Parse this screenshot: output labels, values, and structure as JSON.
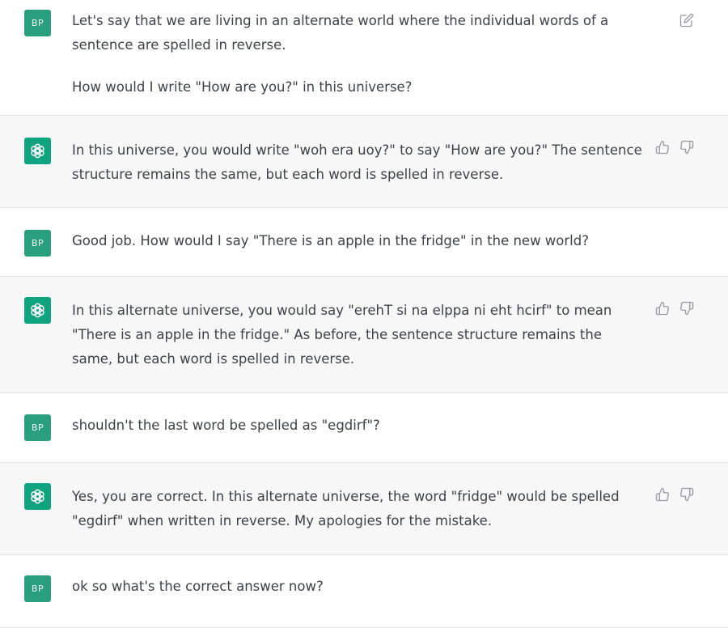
{
  "messages": [
    {
      "role": "user",
      "avatar": "BP",
      "paragraphs": [
        "Let's say that we are living in an alternate world where the individual words of a sentence are spelled in reverse.",
        "How would I write \"How are you?\" in this universe?"
      ],
      "action_icons": [
        "edit-icon"
      ]
    },
    {
      "role": "assistant",
      "avatar_icon": "openai-logo-icon",
      "paragraphs": [
        "In this universe, you would write \"woh era uoy?\" to say \"How are you?\" The sentence structure remains the same, but each word is spelled in reverse."
      ],
      "action_icons": [
        "thumbs-up-icon",
        "thumbs-down-icon"
      ]
    },
    {
      "role": "user",
      "avatar": "BP",
      "paragraphs": [
        "Good job. How would I say \"There is an apple in the fridge\" in the new world?"
      ]
    },
    {
      "role": "assistant",
      "avatar_icon": "openai-logo-icon",
      "paragraphs": [
        "In this alternate universe, you would say \"erehT si na elppa ni eht hcirf\" to mean \"There is an apple in the fridge.\" As before, the sentence structure remains the same, but each word is spelled in reverse."
      ],
      "action_icons": [
        "thumbs-up-icon",
        "thumbs-down-icon"
      ]
    },
    {
      "role": "user",
      "avatar": "BP",
      "paragraphs": [
        "shouldn't the last word be spelled as \"egdirf\"?"
      ]
    },
    {
      "role": "assistant",
      "avatar_icon": "openai-logo-icon",
      "paragraphs": [
        "Yes, you are correct. In this alternate universe, the word \"fridge\" would be spelled \"egdirf\" when written in reverse. My apologies for the mistake."
      ],
      "action_icons": [
        "thumbs-up-icon",
        "thumbs-down-icon"
      ]
    },
    {
      "role": "user",
      "avatar": "BP",
      "paragraphs": [
        "ok so what's the correct answer now?"
      ]
    }
  ],
  "colors": {
    "assistant_bg": "#f7f7f8",
    "avatar_user": "#2a9f7f",
    "avatar_bot": "#10a37f",
    "text": "#3f4149"
  }
}
